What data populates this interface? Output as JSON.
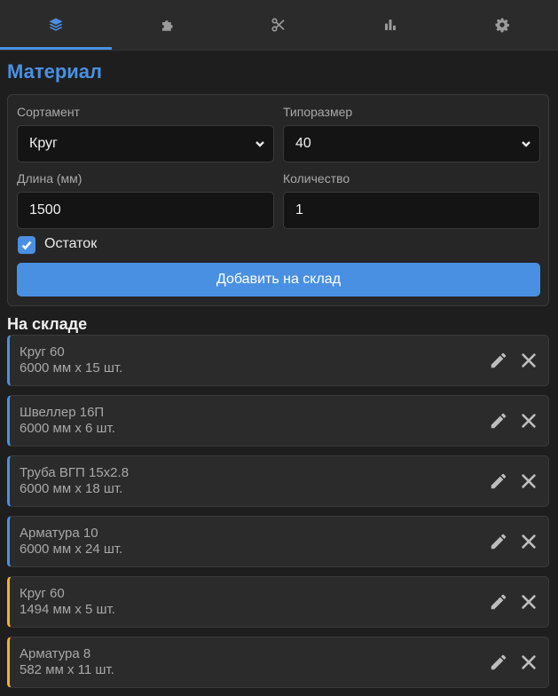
{
  "tabs": [
    {
      "icon": "layers-icon",
      "active": true
    },
    {
      "icon": "puzzle-icon",
      "active": false
    },
    {
      "icon": "scissors-icon",
      "active": false
    },
    {
      "icon": "bar-chart-icon",
      "active": false
    },
    {
      "icon": "gear-icon",
      "active": false
    }
  ],
  "material": {
    "title": "Материал",
    "assortment_label": "Сортамент",
    "assortment_value": "Круг",
    "size_label": "Типоразмер",
    "size_value": "40",
    "length_label": "Длина (мм)",
    "length_value": "1500",
    "quantity_label": "Количество",
    "quantity_value": "1",
    "remnant_label": "Остаток",
    "remnant_checked": true,
    "add_button": "Добавить на склад"
  },
  "stock": {
    "title": "На складе",
    "items": [
      {
        "name": "Круг 60",
        "dims": "6000 мм x 15 шт.",
        "type": "full"
      },
      {
        "name": "Швеллер 16П",
        "dims": "6000 мм x 6 шт.",
        "type": "full"
      },
      {
        "name": "Труба ВГП 15x2.8",
        "dims": "6000 мм x 18 шт.",
        "type": "full"
      },
      {
        "name": "Арматура 10",
        "dims": "6000 мм x 24 шт.",
        "type": "full"
      },
      {
        "name": "Круг 60",
        "dims": "1494 мм x 5 шт.",
        "type": "remnant"
      },
      {
        "name": "Арматура 8",
        "dims": "582 мм x 11 шт.",
        "type": "remnant"
      }
    ]
  },
  "colors": {
    "accent": "#4a90e2",
    "remnant": "#f0b429",
    "background": "#1e1e1e"
  }
}
